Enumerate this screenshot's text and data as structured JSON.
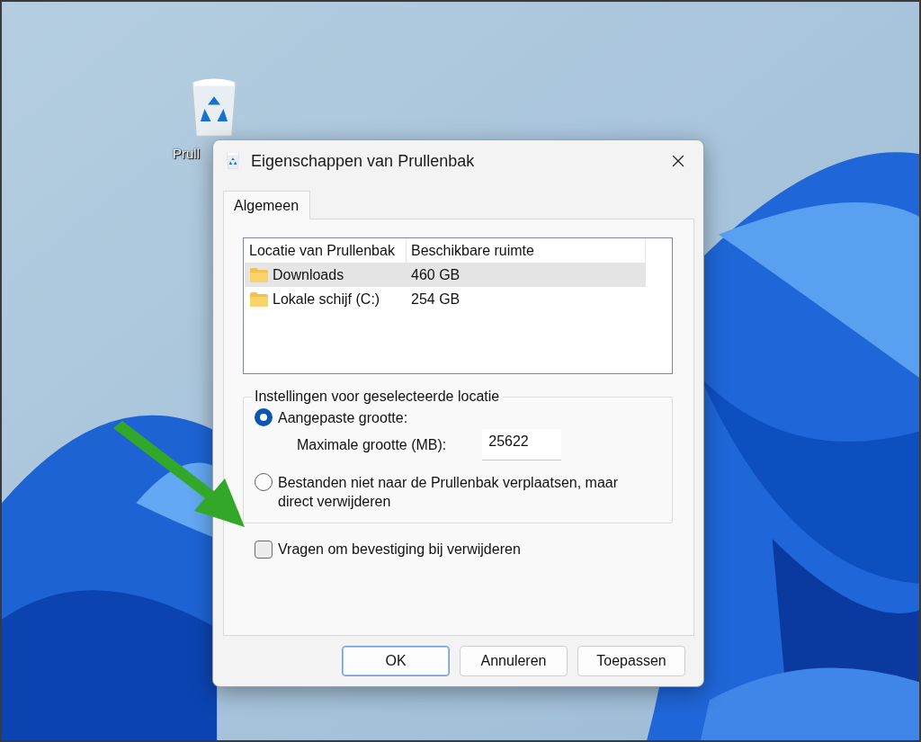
{
  "desktop": {
    "icons": [
      {
        "label": "Prull"
      }
    ]
  },
  "dialog": {
    "title": "Eigenschappen van Prullenbak",
    "tabs": [
      {
        "label": "Algemeen",
        "selected": true
      }
    ],
    "locations": {
      "columns": [
        "Locatie van Prullenbak",
        "Beschikbare ruimte"
      ],
      "rows": [
        {
          "name": "Downloads",
          "space": "460 GB",
          "selected": true
        },
        {
          "name": "Lokale schijf (C:)",
          "space": "254 GB",
          "selected": false
        }
      ]
    },
    "settings": {
      "legend": "Instellingen voor geselecteerde locatie",
      "options": [
        {
          "label": "Aangepaste grootte:",
          "selected": true
        },
        {
          "label": "Bestanden niet naar de Prullenbak verplaatsen, maar direct verwijderen",
          "selected": false
        }
      ],
      "max_size": {
        "label": "Maximale grootte (MB):",
        "value": "25622"
      }
    },
    "confirm": {
      "label": "Vragen om bevestiging bij verwijderen",
      "checked": false
    },
    "buttons": [
      {
        "label": "OK",
        "default": true
      },
      {
        "label": "Annuleren",
        "default": false
      },
      {
        "label": "Toepassen",
        "default": false
      }
    ]
  }
}
